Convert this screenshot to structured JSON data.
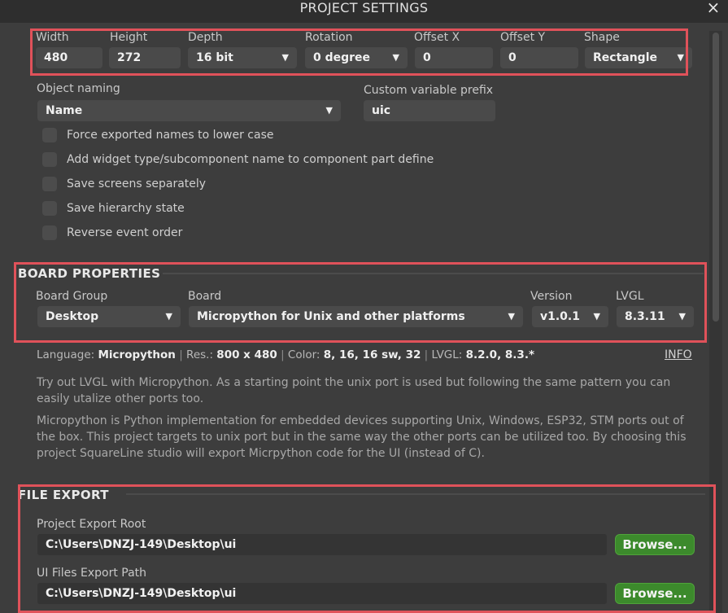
{
  "window": {
    "title": "PROJECT SETTINGS",
    "close_icon": "×"
  },
  "display": {
    "width": {
      "label": "Width",
      "value": "480"
    },
    "height": {
      "label": "Height",
      "value": "272"
    },
    "depth": {
      "label": "Depth",
      "value": "16 bit"
    },
    "rotation": {
      "label": "Rotation",
      "value": "0 degree"
    },
    "offset_x": {
      "label": "Offset X",
      "value": "0"
    },
    "offset_y": {
      "label": "Offset Y",
      "value": "0"
    },
    "shape": {
      "label": "Shape",
      "value": "Rectangle"
    }
  },
  "naming": {
    "object_naming": {
      "label": "Object naming",
      "value": "Name"
    },
    "prefix": {
      "label": "Custom variable prefix",
      "value": "uic"
    }
  },
  "options": [
    {
      "label": "Force exported names to lower case",
      "checked": false
    },
    {
      "label": "Add widget type/subcomponent name to component part define",
      "checked": false
    },
    {
      "label": "Save screens separately",
      "checked": false
    },
    {
      "label": "Save hierarchy state",
      "checked": false
    },
    {
      "label": "Reverse event order",
      "checked": false
    }
  ],
  "board": {
    "section_title": "BOARD PROPERTIES",
    "group": {
      "label": "Board Group",
      "value": "Desktop"
    },
    "board": {
      "label": "Board",
      "value": "Micropython for Unix and other platforms"
    },
    "version": {
      "label": "Version",
      "value": "v1.0.1"
    },
    "lvgl": {
      "label": "LVGL",
      "value": "8.3.11"
    },
    "info": {
      "language_label": "Language:",
      "language": "Micropython",
      "res_label": "Res.:",
      "res": "800 x 480",
      "color_label": "Color:",
      "color": "8, 16, 16 sw, 32",
      "lvgl_label": "LVGL:",
      "lvgl": "8.2.0, 8.3.*",
      "separator": "|",
      "link": "INFO"
    },
    "description_1": "Try out LVGL with Micropython. As a starting point the unix port is used but following the same pattern you can easily utalize other ports too.",
    "description_2": "Micropython is Python implementation for embedded devices supporting Unix, Windows, ESP32, STM ports out of the box. This project targets to unix port but in the same way the other ports can be utilized too. By choosing this project SquareLine studio will export Micrpython code for the UI (instead of C)."
  },
  "file_export": {
    "section_title": "FILE EXPORT",
    "export_root": {
      "label": "Project Export Root",
      "value": "C:\\Users\\DNZJ-149\\Desktop\\ui",
      "button": "Browse..."
    },
    "ui_path": {
      "label": "UI Files Export Path",
      "value": "C:\\Users\\DNZJ-149\\Desktop\\ui",
      "button": "Browse..."
    }
  },
  "icons": {
    "dropdown": "chevron-down-icon",
    "close": "close-icon"
  },
  "colors": {
    "highlight_box": "#e0525a",
    "browse_button": "#3c8a2c",
    "background": "#3d3d3d"
  }
}
